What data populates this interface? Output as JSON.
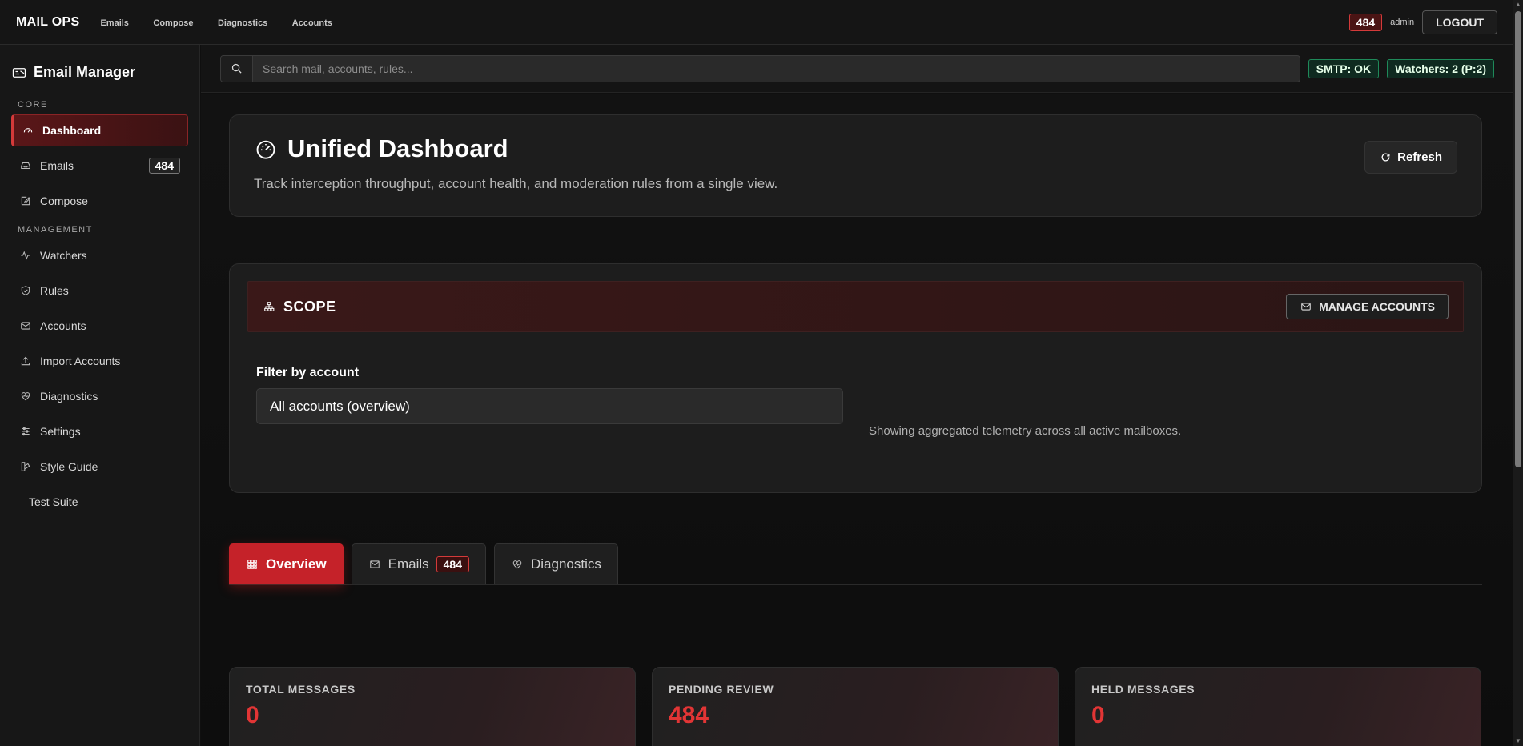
{
  "topbar": {
    "brand": "MAIL OPS",
    "nav": [
      "Emails",
      "Compose",
      "Diagnostics",
      "Accounts"
    ],
    "badge_count": "484",
    "user": "admin",
    "logout_label": "LOGOUT"
  },
  "sidebar": {
    "title": "Email Manager",
    "sections": {
      "core": "CORE",
      "management": "MANAGEMENT"
    },
    "items": [
      {
        "label": "Dashboard",
        "icon": "gauge-icon"
      },
      {
        "label": "Emails",
        "icon": "inbox-icon",
        "count": "484"
      },
      {
        "label": "Compose",
        "icon": "pencil-square-icon"
      },
      {
        "label": "Watchers",
        "icon": "activity-icon"
      },
      {
        "label": "Rules",
        "icon": "shield-check-icon"
      },
      {
        "label": "Accounts",
        "icon": "mail-card-icon"
      },
      {
        "label": "Import Accounts",
        "icon": "upload-icon"
      },
      {
        "label": "Diagnostics",
        "icon": "heart-pulse-icon"
      },
      {
        "label": "Settings",
        "icon": "sliders-icon"
      },
      {
        "label": "Style Guide",
        "icon": "palette-icon"
      },
      {
        "label": "Test Suite",
        "icon": ""
      }
    ]
  },
  "search": {
    "placeholder": "Search mail, accounts, rules...",
    "smtp_status": "SMTP: OK",
    "watchers_status": "Watchers: 2 (P:2)"
  },
  "hero": {
    "title": "Unified Dashboard",
    "subtitle": "Track interception throughput, account health, and moderation rules from a single view.",
    "refresh_label": "Refresh"
  },
  "scope": {
    "title": "SCOPE",
    "manage_label": "MANAGE ACCOUNTS",
    "filter_label": "Filter by account",
    "filter_value": "All accounts (overview)",
    "note": "Showing aggregated telemetry across all active mailboxes."
  },
  "tabs": [
    {
      "label": "Overview",
      "active": true
    },
    {
      "label": "Emails",
      "count": "484"
    },
    {
      "label": "Diagnostics"
    }
  ],
  "stats": [
    {
      "label": "TOTAL MESSAGES",
      "value": "0"
    },
    {
      "label": "PENDING REVIEW",
      "value": "484"
    },
    {
      "label": "HELD MESSAGES",
      "value": "0"
    }
  ],
  "colors": {
    "accent": "#c52229",
    "status_ok": "#1f8a5a",
    "stat_value": "#e23535"
  }
}
